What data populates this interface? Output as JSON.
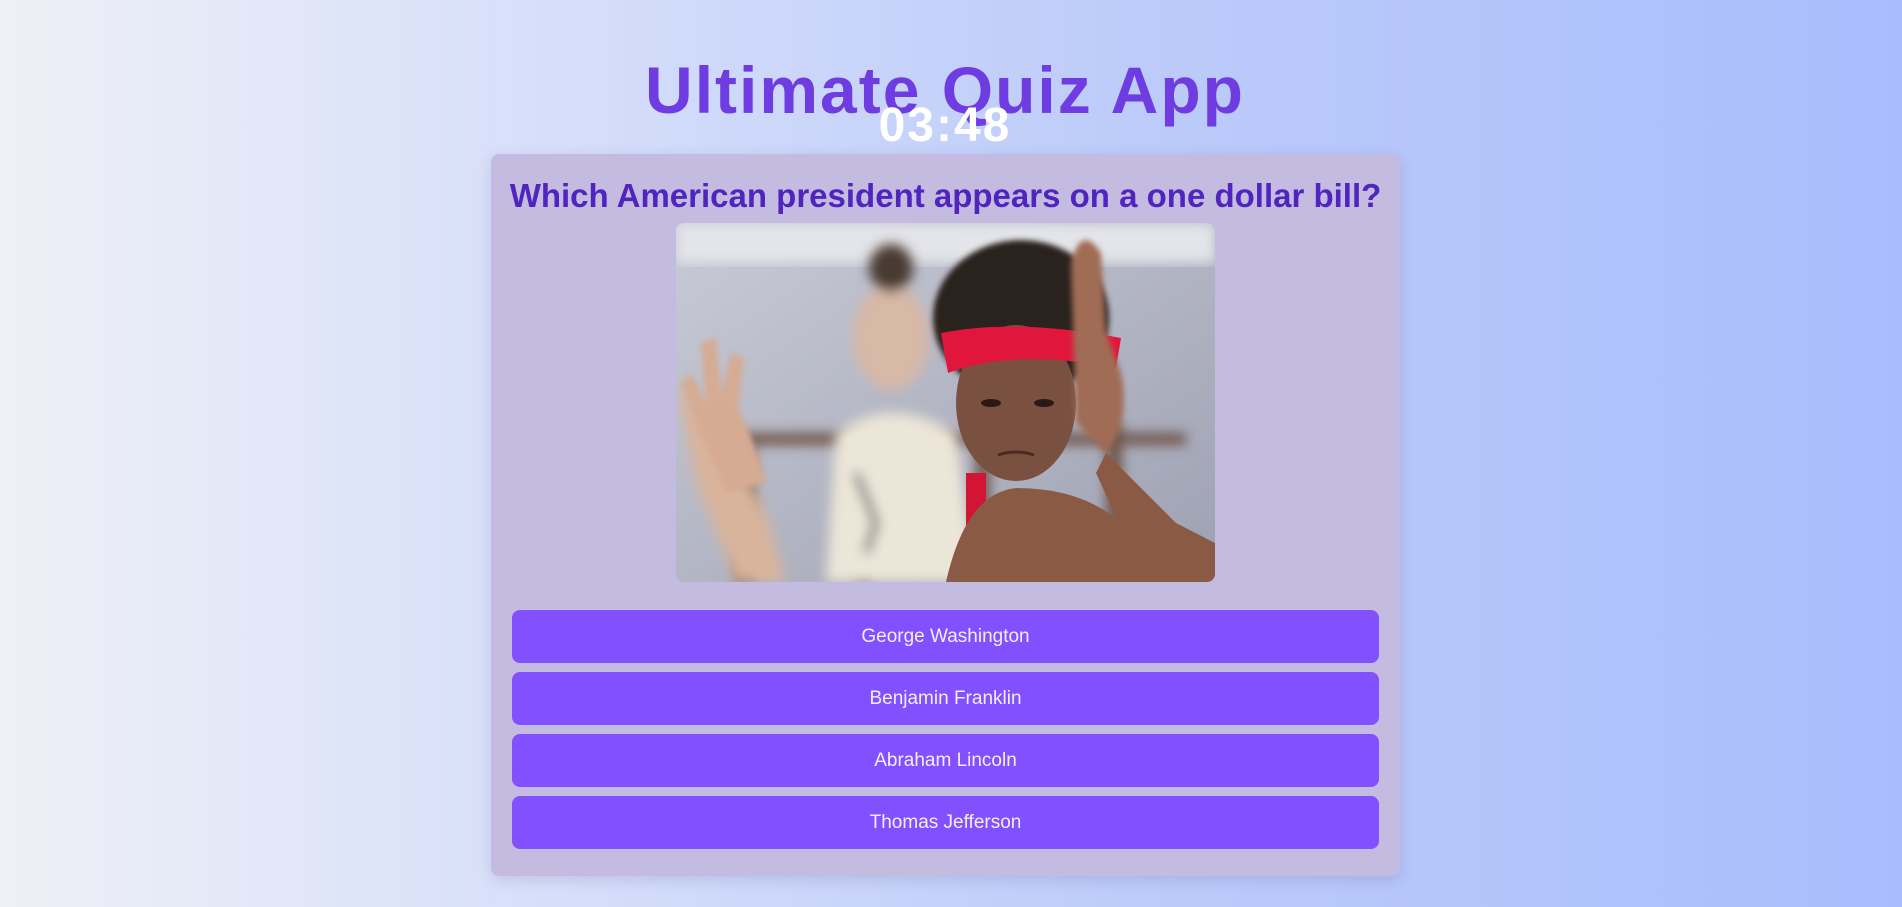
{
  "app": {
    "title": "Ultimate Quiz App",
    "timer": "03:48"
  },
  "quiz": {
    "question": "Which American president appears on a one dollar bill?",
    "image_description_icon": "photo-icon",
    "answers": [
      {
        "label": "George Washington"
      },
      {
        "label": "Benjamin Franklin"
      },
      {
        "label": "Abraham Lincoln"
      },
      {
        "label": "Thomas Jefferson"
      }
    ]
  },
  "colors": {
    "title": "#6e3ce1",
    "question": "#5024bf",
    "card_background": "#c4bce0",
    "answer_button": "#8250ff",
    "timer": "#ffffff"
  }
}
